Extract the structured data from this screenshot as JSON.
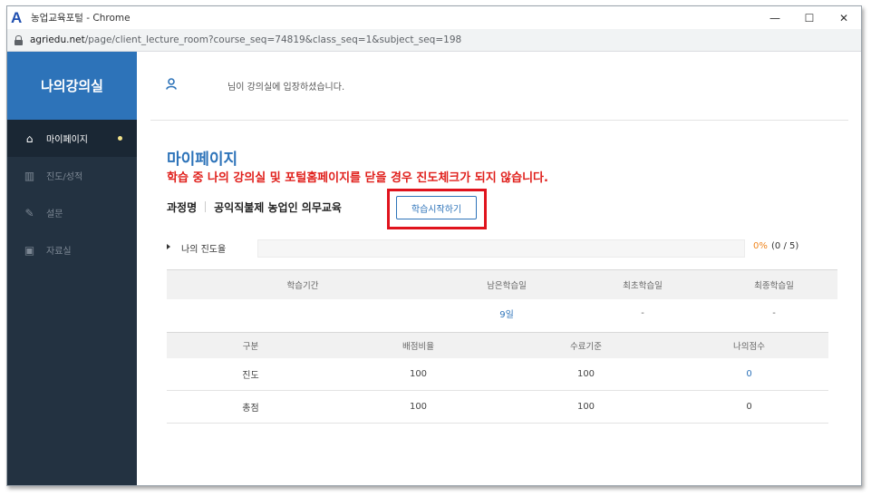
{
  "window": {
    "app_logo": "A",
    "title": "농업교육포털 - Chrome",
    "controls": {
      "minimize": "—",
      "maximize": "☐",
      "close": "✕"
    }
  },
  "address_bar": {
    "url_host": "agriedu.net",
    "url_path": "/page/client_lecture_room?course_seq=74819&class_seq=1&subject_seq=198"
  },
  "sidebar": {
    "header": "나의강의실",
    "items": [
      {
        "label": "마이페이지",
        "icon": "home-icon",
        "glyph": "⌂",
        "active": true
      },
      {
        "label": "진도/성적",
        "icon": "bar-chart-icon",
        "glyph": "▥",
        "active": false
      },
      {
        "label": "설문",
        "icon": "edit-icon",
        "glyph": "✎",
        "active": false
      },
      {
        "label": "자료실",
        "icon": "archive-icon",
        "glyph": "▣",
        "active": false
      }
    ]
  },
  "topbar": {
    "user_icon": "user-icon",
    "welcome_suffix": "님이 강의실에 입장하셨습니다."
  },
  "main": {
    "title": "마이페이지",
    "warning": "학습 중 나의 강의실 및 포털홈페이지를 닫을 경우 진도체크가 되지 않습니다.",
    "course_label": "과정명",
    "course_name": "공익직불제 농업인 의무교육",
    "start_button": "학습시작하기",
    "progress": {
      "label": "나의 진도율",
      "value": 0,
      "percent_text": "0%",
      "count_text": "(0 / 5)"
    },
    "period_table": {
      "headers": [
        "학습기간",
        "남은학습일",
        "최초학습일",
        "최종학습일"
      ],
      "row": [
        "",
        "9일",
        "-",
        "-"
      ]
    },
    "score_table": {
      "headers": [
        "구분",
        "배점비율",
        "수료기준",
        "나의점수"
      ],
      "rows": [
        [
          "진도",
          "100",
          "100",
          "0"
        ],
        [
          "총점",
          "100",
          "100",
          "0"
        ]
      ]
    }
  },
  "colors": {
    "sidebar_bg": "#233241",
    "sidebar_header": "#2d73b9",
    "accent": "#2d73b9",
    "warning": "#e0201c",
    "progress_pct": "#f0851d",
    "highlight": "#e0131d"
  }
}
